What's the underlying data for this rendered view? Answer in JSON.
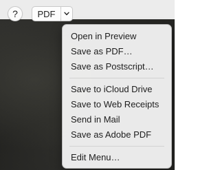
{
  "toolbar": {
    "help_label": "?",
    "pdf_label": "PDF",
    "dropdown_icon": "chevron-down-icon"
  },
  "menu": {
    "group1": [
      "Open in Preview",
      "Save as PDF…",
      "Save as Postscript…"
    ],
    "group2": [
      "Save to iCloud Drive",
      "Save to Web Receipts",
      "Send in Mail",
      "Save as Adobe PDF"
    ],
    "group3": [
      "Edit Menu…"
    ]
  }
}
